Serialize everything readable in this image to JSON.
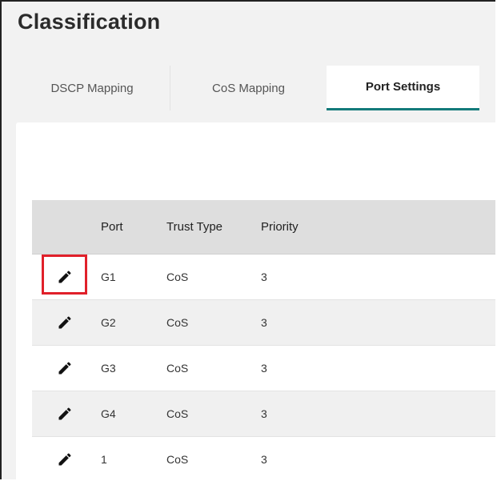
{
  "page": {
    "title": "Classification"
  },
  "tabs": [
    {
      "label": "DSCP Mapping",
      "active": false
    },
    {
      "label": "CoS Mapping",
      "active": false
    },
    {
      "label": "Port Settings",
      "active": true
    }
  ],
  "table": {
    "columns": [
      "",
      "Port",
      "Trust Type",
      "Priority"
    ],
    "rows": [
      {
        "port": "G1",
        "trust_type": "CoS",
        "priority": "3",
        "highlighted": true
      },
      {
        "port": "G2",
        "trust_type": "CoS",
        "priority": "3",
        "highlighted": false
      },
      {
        "port": "G3",
        "trust_type": "CoS",
        "priority": "3",
        "highlighted": false
      },
      {
        "port": "G4",
        "trust_type": "CoS",
        "priority": "3",
        "highlighted": false
      },
      {
        "port": "1",
        "trust_type": "CoS",
        "priority": "3",
        "highlighted": false
      }
    ],
    "row_icon": "pencil-edit-icon"
  },
  "colors": {
    "accent": "#137a7a",
    "highlight": "#e0202a",
    "header_bg": "#dedede"
  }
}
